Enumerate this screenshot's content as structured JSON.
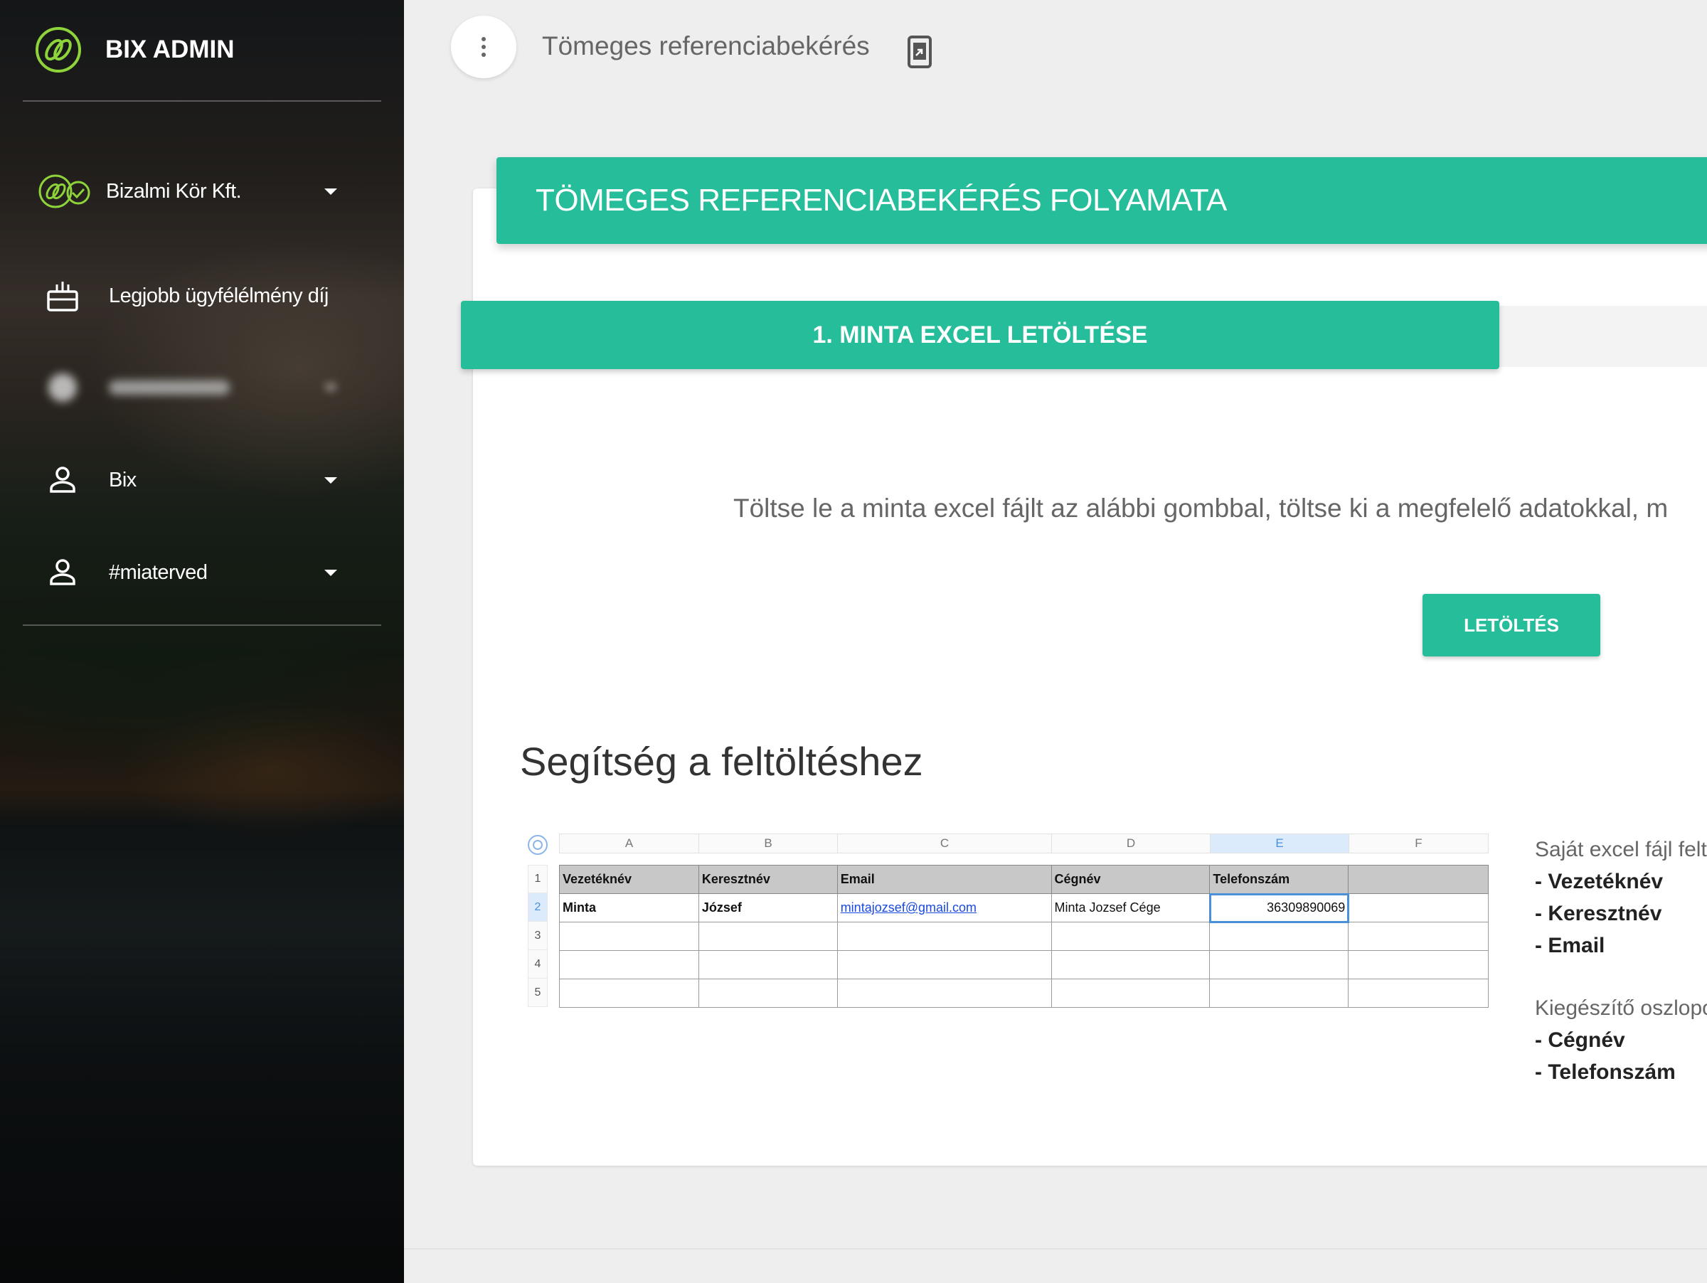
{
  "app": {
    "brand_title": "BIX ADMIN",
    "colors": {
      "accent": "#26bd9a",
      "logo_green": "#8ed33a",
      "sidebar_text": "#ffffff"
    }
  },
  "sidebar": {
    "items": [
      {
        "label": "Bizalmi Kör Kft.",
        "icon": "company-logo-icon",
        "has_dropdown": true
      },
      {
        "label": "Legjobb ügyfélélmény díj",
        "icon": "award-icon",
        "has_dropdown": false
      },
      {
        "label": "",
        "icon": "blurred-icon",
        "has_dropdown": true,
        "blurred": true
      },
      {
        "label": "Bix",
        "icon": "user-icon",
        "has_dropdown": true
      },
      {
        "label": "#miaterved",
        "icon": "user-icon",
        "has_dropdown": true
      }
    ]
  },
  "topbar": {
    "title": "Tömeges referenciabekérés",
    "menu_icon": "more-vert-icon",
    "export_icon": "export-icon"
  },
  "main": {
    "banner_title": "TÖMEGES REFERENCIABEKÉRÉS FOLYAMATA",
    "step_title": "1. MINTA EXCEL LETÖLTÉSE",
    "instruction": "Töltse le a minta excel fájlt az alábbi gombbal, töltse ki a megfelelő adatokkal, m",
    "download_label": "LETÖLTÉS",
    "help_title": "Segítség a feltöltéshez"
  },
  "sheet": {
    "columns": [
      "A",
      "B",
      "C",
      "D",
      "E",
      "F"
    ],
    "rows": [
      "1",
      "2",
      "3",
      "4",
      "5"
    ],
    "header": [
      "Vezetéknév",
      "Keresztnév",
      "Email",
      "Cégnév",
      "Telefonszám",
      ""
    ],
    "sample": [
      "Minta",
      "József",
      "mintajozsef@gmail.com",
      "Minta Jozsef Cége",
      "36309890069",
      ""
    ]
  },
  "info": {
    "required_intro": "Saját excel fájl felt",
    "required": [
      "- Vezetéknév",
      "- Keresztnév",
      "- Email"
    ],
    "optional_intro": "Kiegészítő oszlopo",
    "optional": [
      "- Cégnév",
      "- Telefonszám"
    ]
  }
}
